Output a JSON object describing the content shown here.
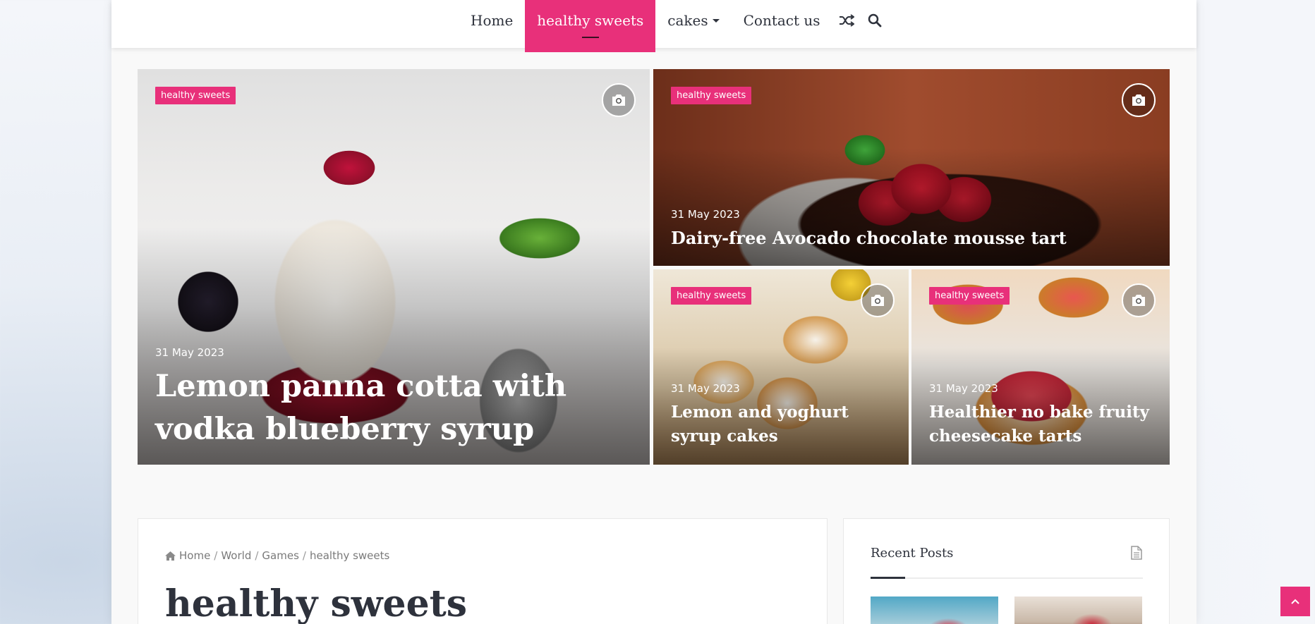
{
  "nav": {
    "items": [
      {
        "label": "Home"
      },
      {
        "label": "healthy sweets"
      },
      {
        "label": "cakes"
      },
      {
        "label": "Contact us"
      }
    ],
    "icons": [
      "shuffle-icon",
      "search-icon"
    ]
  },
  "hero": {
    "main": {
      "badge": "healthy sweets",
      "date": "31 May 2023",
      "title": "Lemon panna cotta with vodka blueberry syrup"
    },
    "top_right": {
      "badge": "healthy sweets",
      "date": "31 May 2023",
      "title": "Dairy-free Avocado chocolate mousse tart"
    },
    "bottom_left": {
      "badge": "healthy sweets",
      "date": "31 May 2023",
      "title": "Lemon and yoghurt syrup cakes"
    },
    "bottom_right": {
      "badge": "healthy sweets",
      "date": "31 May 2023",
      "title": "Healthier no bake fruity cheesecake tarts"
    }
  },
  "breadcrumb": {
    "items": [
      "Home",
      "World",
      "Games",
      "healthy sweets"
    ],
    "separator": "/"
  },
  "page_title": "healthy sweets",
  "sidebar": {
    "widget_title": "Recent Posts"
  },
  "colors": {
    "accent": "#e8307a",
    "text_dark": "#2e323c"
  }
}
